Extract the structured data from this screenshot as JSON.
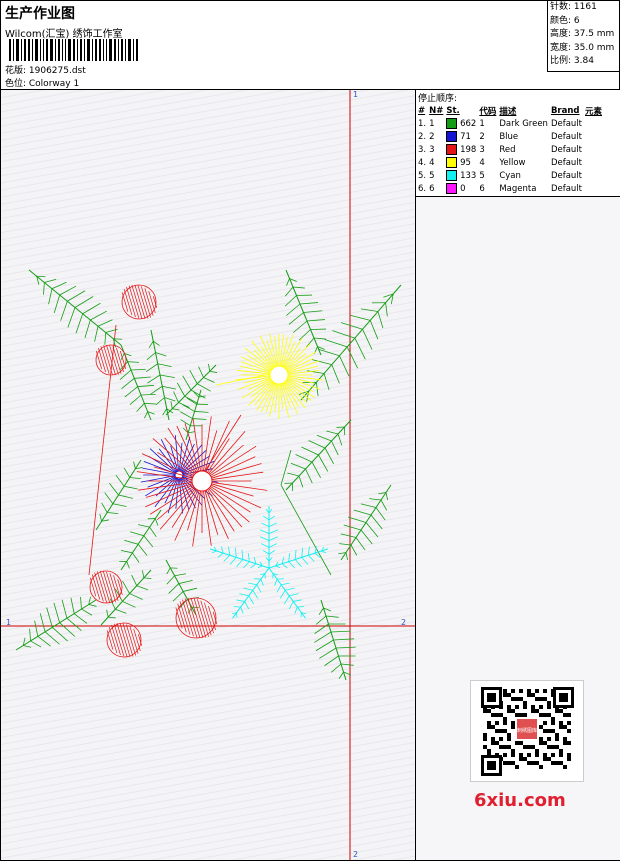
{
  "header": {
    "title": "生产作业图",
    "subtitle": "Wilcom(汇宝) 绣饰工作室",
    "design_label": "花版: 1906275.dst",
    "colorway_label": "色位: Colorway 1"
  },
  "stats": {
    "stitches": "针数: 1161",
    "colors": "颜色: 6",
    "height": "高度: 37.5 mm",
    "width": "宽度: 35.0 mm",
    "scale": "比例: 3.84"
  },
  "legend": {
    "heading": "停止顺序:",
    "columns": [
      "#",
      "N#",
      "St.",
      "代码",
      "描述",
      "Brand",
      "元素"
    ],
    "rows": [
      {
        "idx": "1.",
        "n": "1",
        "color": "#149c14",
        "st": "662",
        "code": "1",
        "desc": "Dark Green",
        "brand": "Default"
      },
      {
        "idx": "2.",
        "n": "2",
        "color": "#1414d2",
        "st": "71",
        "code": "2",
        "desc": "Blue",
        "brand": "Default"
      },
      {
        "idx": "3.",
        "n": "3",
        "color": "#e61414",
        "st": "198",
        "code": "3",
        "desc": "Red",
        "brand": "Default"
      },
      {
        "idx": "4.",
        "n": "4",
        "color": "#ffff00",
        "st": "95",
        "code": "4",
        "desc": "Yellow",
        "brand": "Default"
      },
      {
        "idx": "5.",
        "n": "5",
        "color": "#14f0f0",
        "st": "133",
        "code": "5",
        "desc": "Cyan",
        "brand": "Default"
      },
      {
        "idx": "6.",
        "n": "6",
        "color": "#ff14ff",
        "st": "0",
        "code": "6",
        "desc": "Magenta",
        "brand": "Default"
      }
    ]
  },
  "axes": {
    "top_marker": "1",
    "left_marker": "1",
    "right_marker": "2",
    "bottom_marker": "2",
    "color": "#cc0000"
  },
  "watermark": "6xiu.com",
  "qr_badge": "刺绣图库"
}
